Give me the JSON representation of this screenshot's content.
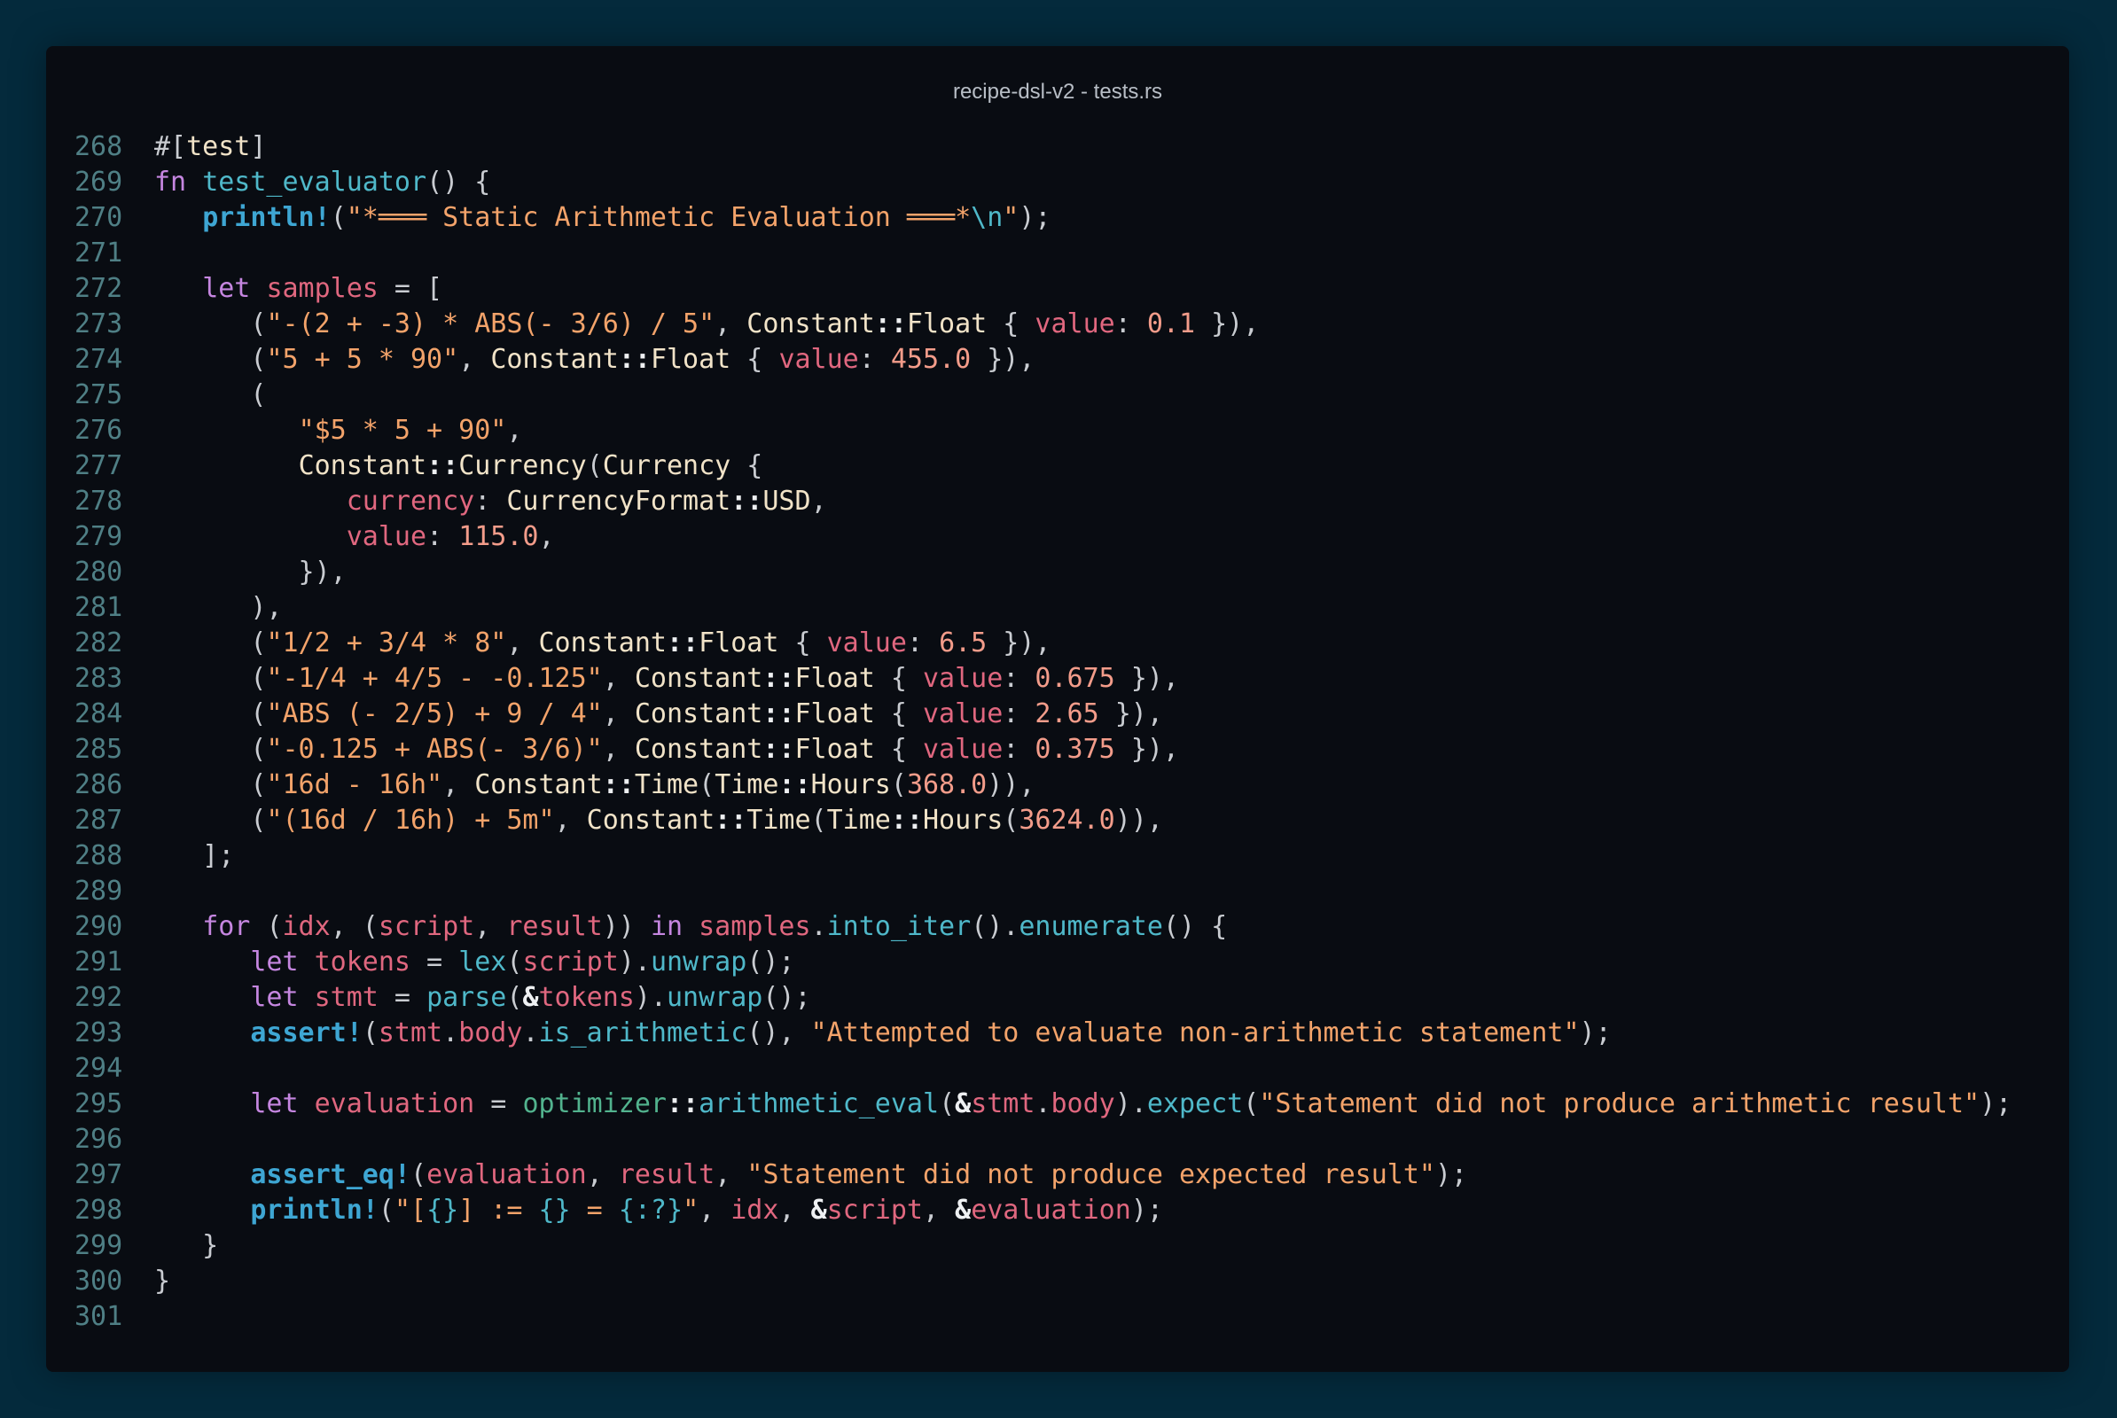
{
  "window": {
    "title": "recipe-dsl-v2 - tests.rs"
  },
  "editor": {
    "lines": [
      {
        "num": "268",
        "tokens": [
          [
            "p",
            "#["
          ],
          [
            "at",
            "test"
          ],
          [
            "p",
            "]"
          ]
        ]
      },
      {
        "num": "269",
        "tokens": [
          [
            "kw",
            "fn "
          ],
          [
            "fn",
            "test_evaluator"
          ],
          [
            "p",
            "() {"
          ]
        ]
      },
      {
        "num": "270",
        "tokens": [
          [
            "p",
            "   "
          ],
          [
            "mac",
            "println!"
          ],
          [
            "p",
            "("
          ],
          [
            "str",
            "\"*═══ Static Arithmetic Evaluation ═══*"
          ],
          [
            "esc",
            "\\n"
          ],
          [
            "str",
            "\""
          ],
          [
            "p",
            ");"
          ]
        ]
      },
      {
        "num": "271",
        "tokens": []
      },
      {
        "num": "272",
        "tokens": [
          [
            "p",
            "   "
          ],
          [
            "kw",
            "let "
          ],
          [
            "var",
            "samples"
          ],
          [
            "p",
            " = ["
          ]
        ]
      },
      {
        "num": "273",
        "tokens": [
          [
            "p",
            "      ("
          ],
          [
            "str",
            "\"-(2 + -3) * ABS(- 3/6) / 5\""
          ],
          [
            "p",
            ", "
          ],
          [
            "ty",
            "Constant"
          ],
          [
            "op",
            "::"
          ],
          [
            "ty",
            "Float"
          ],
          [
            "p",
            " { "
          ],
          [
            "var",
            "value"
          ],
          [
            "p",
            ": "
          ],
          [
            "num",
            "0.1"
          ],
          [
            "p",
            " }),"
          ]
        ]
      },
      {
        "num": "274",
        "tokens": [
          [
            "p",
            "      ("
          ],
          [
            "str",
            "\"5 + 5 * 90\""
          ],
          [
            "p",
            ", "
          ],
          [
            "ty",
            "Constant"
          ],
          [
            "op",
            "::"
          ],
          [
            "ty",
            "Float"
          ],
          [
            "p",
            " { "
          ],
          [
            "var",
            "value"
          ],
          [
            "p",
            ": "
          ],
          [
            "num",
            "455.0"
          ],
          [
            "p",
            " }),"
          ]
        ]
      },
      {
        "num": "275",
        "tokens": [
          [
            "p",
            "      ("
          ]
        ]
      },
      {
        "num": "276",
        "tokens": [
          [
            "p",
            "         "
          ],
          [
            "str",
            "\"$5 * 5 + 90\""
          ],
          [
            "p",
            ","
          ]
        ]
      },
      {
        "num": "277",
        "tokens": [
          [
            "p",
            "         "
          ],
          [
            "ty",
            "Constant"
          ],
          [
            "op",
            "::"
          ],
          [
            "ty",
            "Currency"
          ],
          [
            "p",
            "("
          ],
          [
            "ty",
            "Currency"
          ],
          [
            "p",
            " {"
          ]
        ]
      },
      {
        "num": "278",
        "tokens": [
          [
            "p",
            "            "
          ],
          [
            "var",
            "currency"
          ],
          [
            "p",
            ": "
          ],
          [
            "ty",
            "CurrencyFormat"
          ],
          [
            "op",
            "::"
          ],
          [
            "ty",
            "USD"
          ],
          [
            "p",
            ","
          ]
        ]
      },
      {
        "num": "279",
        "tokens": [
          [
            "p",
            "            "
          ],
          [
            "var",
            "value"
          ],
          [
            "p",
            ": "
          ],
          [
            "num",
            "115.0"
          ],
          [
            "p",
            ","
          ]
        ]
      },
      {
        "num": "280",
        "tokens": [
          [
            "p",
            "         }),"
          ]
        ]
      },
      {
        "num": "281",
        "tokens": [
          [
            "p",
            "      ),"
          ]
        ]
      },
      {
        "num": "282",
        "tokens": [
          [
            "p",
            "      ("
          ],
          [
            "str",
            "\"1/2 + 3/4 * 8\""
          ],
          [
            "p",
            ", "
          ],
          [
            "ty",
            "Constant"
          ],
          [
            "op",
            "::"
          ],
          [
            "ty",
            "Float"
          ],
          [
            "p",
            " { "
          ],
          [
            "var",
            "value"
          ],
          [
            "p",
            ": "
          ],
          [
            "num",
            "6.5"
          ],
          [
            "p",
            " }),"
          ]
        ]
      },
      {
        "num": "283",
        "tokens": [
          [
            "p",
            "      ("
          ],
          [
            "str",
            "\"-1/4 + 4/5 - -0.125\""
          ],
          [
            "p",
            ", "
          ],
          [
            "ty",
            "Constant"
          ],
          [
            "op",
            "::"
          ],
          [
            "ty",
            "Float"
          ],
          [
            "p",
            " { "
          ],
          [
            "var",
            "value"
          ],
          [
            "p",
            ": "
          ],
          [
            "num",
            "0.675"
          ],
          [
            "p",
            " }),"
          ]
        ]
      },
      {
        "num": "284",
        "tokens": [
          [
            "p",
            "      ("
          ],
          [
            "str",
            "\"ABS (- 2/5) + 9 / 4\""
          ],
          [
            "p",
            ", "
          ],
          [
            "ty",
            "Constant"
          ],
          [
            "op",
            "::"
          ],
          [
            "ty",
            "Float"
          ],
          [
            "p",
            " { "
          ],
          [
            "var",
            "value"
          ],
          [
            "p",
            ": "
          ],
          [
            "num",
            "2.65"
          ],
          [
            "p",
            " }),"
          ]
        ]
      },
      {
        "num": "285",
        "tokens": [
          [
            "p",
            "      ("
          ],
          [
            "str",
            "\"-0.125 + ABS(- 3/6)\""
          ],
          [
            "p",
            ", "
          ],
          [
            "ty",
            "Constant"
          ],
          [
            "op",
            "::"
          ],
          [
            "ty",
            "Float"
          ],
          [
            "p",
            " { "
          ],
          [
            "var",
            "value"
          ],
          [
            "p",
            ": "
          ],
          [
            "num",
            "0.375"
          ],
          [
            "p",
            " }),"
          ]
        ]
      },
      {
        "num": "286",
        "tokens": [
          [
            "p",
            "      ("
          ],
          [
            "str",
            "\"16d - 16h\""
          ],
          [
            "p",
            ", "
          ],
          [
            "ty",
            "Constant"
          ],
          [
            "op",
            "::"
          ],
          [
            "ty",
            "Time"
          ],
          [
            "p",
            "("
          ],
          [
            "ty",
            "Time"
          ],
          [
            "op",
            "::"
          ],
          [
            "ty",
            "Hours"
          ],
          [
            "p",
            "("
          ],
          [
            "num",
            "368.0"
          ],
          [
            "p",
            ")),"
          ]
        ]
      },
      {
        "num": "287",
        "tokens": [
          [
            "p",
            "      ("
          ],
          [
            "str",
            "\"(16d / 16h) + 5m\""
          ],
          [
            "p",
            ", "
          ],
          [
            "ty",
            "Constant"
          ],
          [
            "op",
            "::"
          ],
          [
            "ty",
            "Time"
          ],
          [
            "p",
            "("
          ],
          [
            "ty",
            "Time"
          ],
          [
            "op",
            "::"
          ],
          [
            "ty",
            "Hours"
          ],
          [
            "p",
            "("
          ],
          [
            "num",
            "3624.0"
          ],
          [
            "p",
            ")),"
          ]
        ]
      },
      {
        "num": "288",
        "tokens": [
          [
            "p",
            "   ];"
          ]
        ]
      },
      {
        "num": "289",
        "tokens": []
      },
      {
        "num": "290",
        "tokens": [
          [
            "p",
            "   "
          ],
          [
            "kw",
            "for "
          ],
          [
            "p",
            "("
          ],
          [
            "var",
            "idx"
          ],
          [
            "p",
            ", ("
          ],
          [
            "var",
            "script"
          ],
          [
            "p",
            ", "
          ],
          [
            "var",
            "result"
          ],
          [
            "p",
            ")) "
          ],
          [
            "kw",
            "in "
          ],
          [
            "var",
            "samples"
          ],
          [
            "p",
            "."
          ],
          [
            "fn",
            "into_iter"
          ],
          [
            "p",
            "()."
          ],
          [
            "fn",
            "enumerate"
          ],
          [
            "p",
            "() {"
          ]
        ]
      },
      {
        "num": "291",
        "tokens": [
          [
            "p",
            "      "
          ],
          [
            "kw",
            "let "
          ],
          [
            "var",
            "tokens"
          ],
          [
            "p",
            " = "
          ],
          [
            "fn",
            "lex"
          ],
          [
            "p",
            "("
          ],
          [
            "var",
            "script"
          ],
          [
            "p",
            ")."
          ],
          [
            "fn",
            "unwrap"
          ],
          [
            "p",
            "();"
          ]
        ]
      },
      {
        "num": "292",
        "tokens": [
          [
            "p",
            "      "
          ],
          [
            "kw",
            "let "
          ],
          [
            "var",
            "stmt"
          ],
          [
            "p",
            " = "
          ],
          [
            "fn",
            "parse"
          ],
          [
            "p",
            "("
          ],
          [
            "op",
            "&"
          ],
          [
            "var",
            "tokens"
          ],
          [
            "p",
            ")."
          ],
          [
            "fn",
            "unwrap"
          ],
          [
            "p",
            "();"
          ]
        ]
      },
      {
        "num": "293",
        "tokens": [
          [
            "p",
            "      "
          ],
          [
            "mac",
            "assert!"
          ],
          [
            "p",
            "("
          ],
          [
            "var",
            "stmt"
          ],
          [
            "p",
            "."
          ],
          [
            "var",
            "body"
          ],
          [
            "p",
            "."
          ],
          [
            "fn",
            "is_arithmetic"
          ],
          [
            "p",
            "(), "
          ],
          [
            "str",
            "\"Attempted to evaluate non-arithmetic statement\""
          ],
          [
            "p",
            ");"
          ]
        ]
      },
      {
        "num": "294",
        "tokens": []
      },
      {
        "num": "295",
        "tokens": [
          [
            "p",
            "      "
          ],
          [
            "kw",
            "let "
          ],
          [
            "var",
            "evaluation"
          ],
          [
            "p",
            " = "
          ],
          [
            "mod",
            "optimizer"
          ],
          [
            "op",
            "::"
          ],
          [
            "fn",
            "arithmetic_eval"
          ],
          [
            "p",
            "("
          ],
          [
            "op",
            "&"
          ],
          [
            "var",
            "stmt"
          ],
          [
            "p",
            "."
          ],
          [
            "var",
            "body"
          ],
          [
            "p",
            ")."
          ],
          [
            "fn",
            "expect"
          ],
          [
            "p",
            "("
          ],
          [
            "str",
            "\"Statement did not produce arithmetic result\""
          ],
          [
            "p",
            ");"
          ]
        ]
      },
      {
        "num": "296",
        "tokens": []
      },
      {
        "num": "297",
        "tokens": [
          [
            "p",
            "      "
          ],
          [
            "mac",
            "assert_eq!"
          ],
          [
            "p",
            "("
          ],
          [
            "var",
            "evaluation"
          ],
          [
            "p",
            ", "
          ],
          [
            "var",
            "result"
          ],
          [
            "p",
            ", "
          ],
          [
            "str",
            "\"Statement did not produce expected result\""
          ],
          [
            "p",
            ");"
          ]
        ]
      },
      {
        "num": "298",
        "tokens": [
          [
            "p",
            "      "
          ],
          [
            "mac",
            "println!"
          ],
          [
            "p",
            "("
          ],
          [
            "str",
            "\"["
          ],
          [
            "esc",
            "{}"
          ],
          [
            "str",
            "] := "
          ],
          [
            "esc",
            "{}"
          ],
          [
            "str",
            " = "
          ],
          [
            "esc",
            "{:?}"
          ],
          [
            "str",
            "\""
          ],
          [
            "p",
            ", "
          ],
          [
            "var",
            "idx"
          ],
          [
            "p",
            ", "
          ],
          [
            "op",
            "&"
          ],
          [
            "var",
            "script"
          ],
          [
            "p",
            ", "
          ],
          [
            "op",
            "&"
          ],
          [
            "var",
            "evaluation"
          ],
          [
            "p",
            ");"
          ]
        ]
      },
      {
        "num": "299",
        "tokens": [
          [
            "p",
            "   }"
          ]
        ]
      },
      {
        "num": "300",
        "tokens": [
          [
            "p",
            "}"
          ]
        ]
      },
      {
        "num": "301",
        "tokens": []
      }
    ]
  }
}
